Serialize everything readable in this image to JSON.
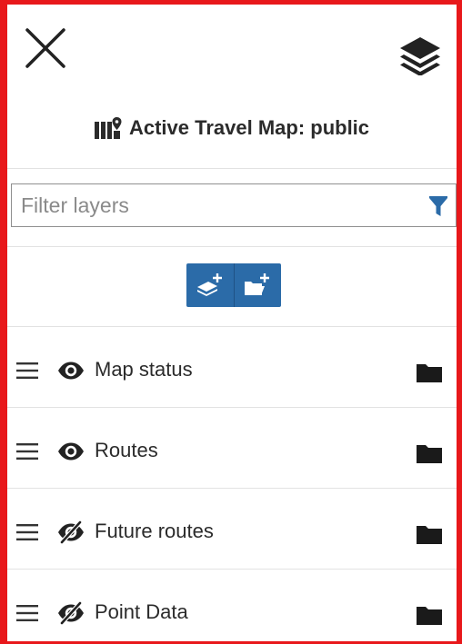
{
  "header": {
    "close_icon": "close-icon",
    "layers_icon": "layers-stack-icon"
  },
  "title": {
    "icon": "map-marker-icon",
    "text": "Active Travel Map: public"
  },
  "filter": {
    "placeholder": "Filter layers",
    "value": "",
    "icon": "filter-funnel-icon",
    "icon_color": "#2b6ba8"
  },
  "actions": {
    "color": "#2b6ba8",
    "buttons": [
      {
        "icon": "add-layer-icon"
      },
      {
        "icon": "add-folder-icon"
      }
    ]
  },
  "layers": [
    {
      "label": "Map status",
      "visible": true,
      "visibility_icon": "eye-icon",
      "folder_icon": "folder-icon"
    },
    {
      "label": "Routes",
      "visible": true,
      "visibility_icon": "eye-icon",
      "folder_icon": "folder-icon"
    },
    {
      "label": "Future routes",
      "visible": false,
      "visibility_icon": "eye-slash-icon",
      "folder_icon": "folder-icon"
    },
    {
      "label": "Point Data",
      "visible": false,
      "visibility_icon": "eye-slash-icon",
      "folder_icon": "folder-icon"
    }
  ]
}
